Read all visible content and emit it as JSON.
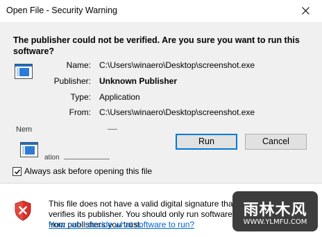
{
  "window": {
    "title": "Open File - Security Warning"
  },
  "warning": {
    "heading": "The publisher could not be verified.  Are you sure you want to run this software?"
  },
  "details": {
    "name_label": "Name:",
    "name_value": "C:\\Users\\winaero\\Desktop\\screenshot.exe",
    "publisher_label": "Publisher:",
    "publisher_value": "Unknown Publisher",
    "type_label": "Type:",
    "type_value": "Application",
    "from_label": "From:",
    "from_value": "C:\\Users\\winaero\\Desktop\\screenshot.exe"
  },
  "artifacts": {
    "garble1": "Nem",
    "garble2": "ation"
  },
  "buttons": {
    "run": "Run",
    "cancel": "Cancel"
  },
  "checkbox": {
    "label": "Always ask before opening this file",
    "checked": true
  },
  "footer": {
    "text": "This file does not have a valid digital signature that verifies its publisher.  You should only run software from publishers you trust.",
    "link": "How can I decide what software to run?"
  },
  "watermark": {
    "text": "雨林木风",
    "url": "WWW.YLMFU.COM"
  },
  "colors": {
    "accent": "#0078d7",
    "link": "#0066cc",
    "shield": "#d9312a"
  },
  "icons": [
    "close-icon",
    "program-icon",
    "checkmark-icon",
    "shield-error-icon"
  ]
}
